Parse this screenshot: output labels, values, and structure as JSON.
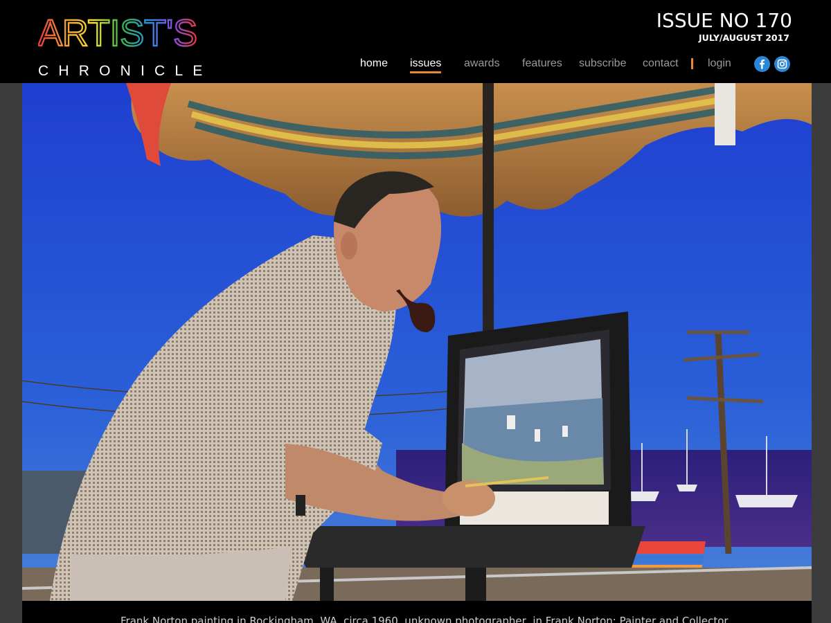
{
  "header": {
    "logo": {
      "title": "ARTIST'S",
      "subtitle": "CHRONICLE",
      "title_colors": [
        "#e8393f",
        "#f2a33a",
        "#f7e03c",
        "#3ab54a",
        "#2f8de4",
        "#8b4bd6",
        "#e8393f"
      ]
    },
    "issue": {
      "number": "ISSUE NO 170",
      "date": "JULY/AUGUST 2017"
    },
    "nav": {
      "items": [
        {
          "label": "home"
        },
        {
          "label": "issues"
        },
        {
          "label": "awards"
        },
        {
          "label": "features"
        },
        {
          "label": "subscribe"
        },
        {
          "label": "contact"
        },
        {
          "label": "login"
        }
      ],
      "current_item": "issues",
      "accent_color": "#e8872f"
    },
    "social": [
      {
        "icon": "facebook-icon",
        "glyph": "f"
      },
      {
        "icon": "instagram-icon",
        "glyph": "◎"
      }
    ]
  },
  "hero": {
    "description_icon": "photo-painter-at-easel"
  },
  "caption": {
    "text": "Frank Norton painting in Rockingham, WA, circa 1960, unknown photographer, in Frank Norton: Painter and Collector"
  }
}
